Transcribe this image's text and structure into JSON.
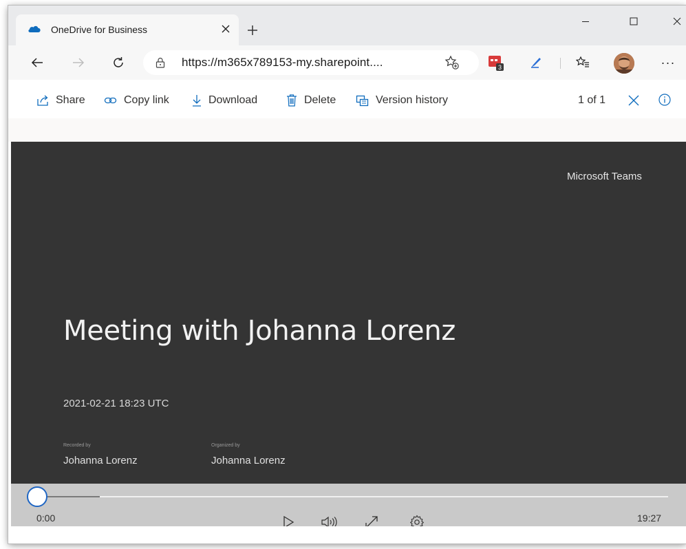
{
  "browser": {
    "tab": {
      "title": "OneDrive for Business",
      "favicon": "onedrive-cloud-icon",
      "close_glyph": "✕"
    },
    "new_tab_icon": "plus-icon",
    "window_controls": [
      "minimize-icon",
      "maximize-icon",
      "close-icon"
    ],
    "address": {
      "url": "https://m365x789153-my.sharepoint....",
      "lock_icon": "lock-icon"
    },
    "extension_badge": "3",
    "more_glyph": "···"
  },
  "commands": {
    "share": "Share",
    "copy_link": "Copy link",
    "download": "Download",
    "delete": "Delete",
    "version_history": "Version history",
    "count": "1 of 1"
  },
  "video": {
    "brand": "Microsoft Teams",
    "title": "Meeting with Johanna Lorenz",
    "date": "2021-02-21 18:23 UTC",
    "recorded_by_label": "Recorded by",
    "recorded_by": "Johanna Lorenz",
    "organized_by_label": "Organized by",
    "organized_by": "Johanna Lorenz"
  },
  "player": {
    "current_time": "0:00",
    "duration": "19:27",
    "progress": 0,
    "buffered_fraction": 0.1
  },
  "colors": {
    "accent": "#0f6cbd",
    "video_bg": "#343434",
    "controls_bg": "#c9c9c9"
  }
}
